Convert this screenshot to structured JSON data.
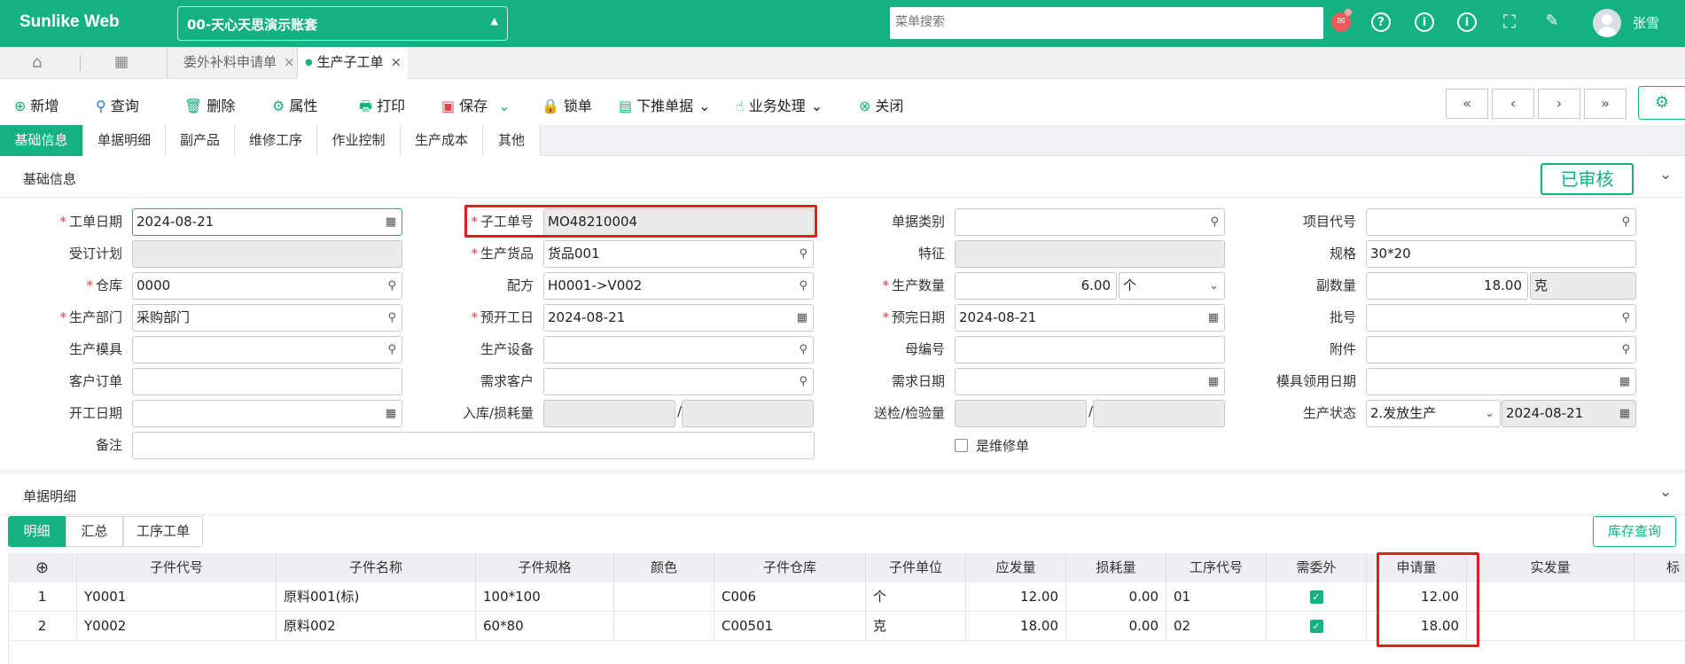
{
  "app": {
    "brand": "Sunlike Web",
    "account": "00-天心天思演示账套",
    "menu_search_placeholder": "菜单搜索",
    "user": "张雪"
  },
  "tabs": [
    {
      "label": "委外补料申请单"
    },
    {
      "label": "生产子工单"
    }
  ],
  "toolbar": {
    "add": "新增",
    "query": "查询",
    "delete": "删除",
    "props": "属性",
    "print": "打印",
    "save": "保存",
    "lock": "锁单",
    "push": "下推单据",
    "business": "业务处理",
    "close": "关闭"
  },
  "subtabs": [
    "基础信息",
    "单据明细",
    "副产品",
    "维修工序",
    "作业控制",
    "生产成本",
    "其他"
  ],
  "basic": {
    "title": "基础信息",
    "status": "已审核",
    "labels": {
      "work_date": "工单日期",
      "order_plan": "受订计划",
      "warehouse": "仓库",
      "dept": "生产部门",
      "mold": "生产模具",
      "cust_order": "客户订单",
      "start_date": "开工日期",
      "remark": "备注",
      "sub_no": "子工单号",
      "product": "生产货品",
      "formula": "配方",
      "plan_start": "预开工日",
      "equipment": "生产设备",
      "demand_cust": "需求客户",
      "stock_loss": "入库/损耗量",
      "doc_type": "单据类别",
      "feature": "特征",
      "qty": "生产数量",
      "plan_finish": "预完日期",
      "parent_no": "母编号",
      "demand_date": "需求日期",
      "inspect_qty": "送检/检验量",
      "repair": "是维修单",
      "project": "项目代号",
      "spec": "规格",
      "sub_qty": "副数量",
      "batch": "批号",
      "attachment": "附件",
      "mold_date": "模具领用日期",
      "prod_status": "生产状态"
    },
    "values": {
      "work_date": "2024-08-21",
      "warehouse": "0000",
      "dept": "采购部门",
      "sub_no": "MO48210004",
      "product": "货品001",
      "formula": "H0001->V002",
      "plan_start": "2024-08-21",
      "qty": "6.00",
      "qty_unit": "个",
      "plan_finish": "2024-08-21",
      "spec": "30*20",
      "sub_qty": "18.00",
      "sub_unit": "克",
      "prod_status": "2.发放生产",
      "status_date": "2024-08-21",
      "slash": "/"
    }
  },
  "detail": {
    "title": "单据明细",
    "tabs": [
      "明细",
      "汇总",
      "工序工单"
    ],
    "stock_query": "库存查询",
    "columns": [
      "子件代号",
      "子件名称",
      "子件规格",
      "颜色",
      "子件仓库",
      "子件单位",
      "应发量",
      "损耗量",
      "工序代号",
      "需委外",
      "申请量",
      "实发量",
      "标准"
    ],
    "rows": [
      {
        "no": "1",
        "code": "Y0001",
        "name": "原料001(标)",
        "spec": "100*100",
        "color": "",
        "wh": "C006",
        "unit": "个",
        "due": "12.00",
        "loss": "0.00",
        "proc": "01",
        "outsource": true,
        "apply": "12.00",
        "actual": ""
      },
      {
        "no": "2",
        "code": "Y0002",
        "name": "原料002",
        "spec": "60*80",
        "color": "",
        "wh": "C00501",
        "unit": "克",
        "due": "18.00",
        "loss": "0.00",
        "proc": "02",
        "outsource": true,
        "apply": "18.00",
        "actual": ""
      }
    ]
  },
  "colors": {
    "accent": "#14b282",
    "highlight": "#e02020",
    "required": "#e23a3a"
  }
}
